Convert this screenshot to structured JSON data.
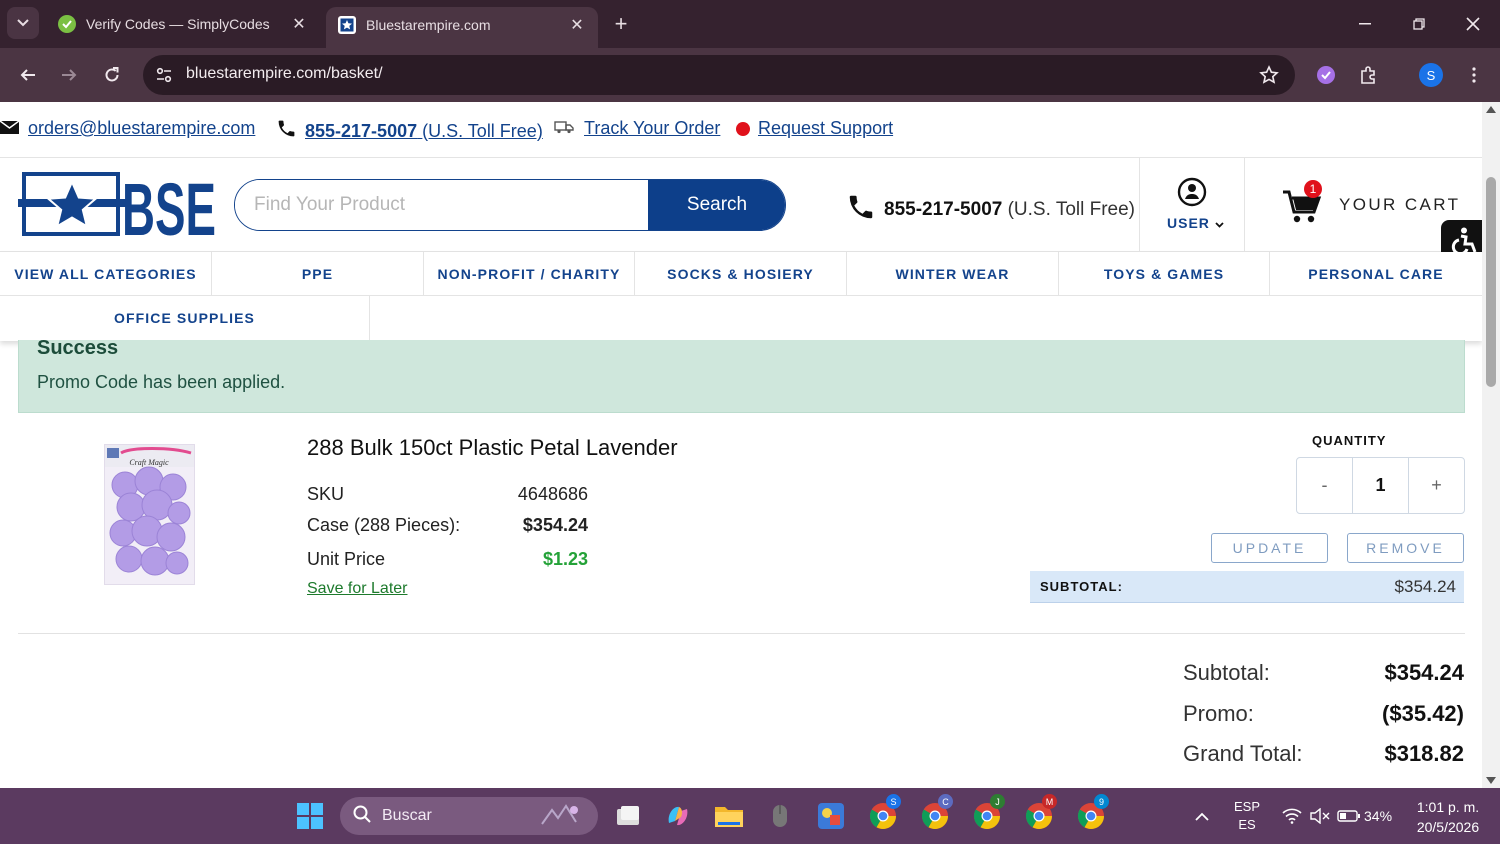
{
  "browser": {
    "tabs": [
      {
        "title": "Verify Codes — SimplyCodes",
        "active": false
      },
      {
        "title": "Bluestarempire.com",
        "active": true
      }
    ],
    "url": "bluestarempire.com/basket/",
    "profile_initial": "S"
  },
  "topbar": {
    "email": "orders@bluestarempire.com",
    "phone": "855-217-5007",
    "phone_note": "(U.S. Toll Free)",
    "track": "Track Your Order",
    "support": "Request Support"
  },
  "header": {
    "logo_text": "BSE",
    "search_placeholder": "Find Your Product",
    "search_button": "Search",
    "phone": "855-217-5007",
    "phone_note": "(U.S. Toll Free)",
    "user_label": "USER",
    "cart_label": "YOUR CART",
    "cart_count": "1"
  },
  "categories": [
    "VIEW ALL CATEGORIES",
    "PPE",
    "NON-PROFIT / CHARITY",
    "SOCKS & HOSIERY",
    "WINTER WEAR",
    "TOYS & GAMES",
    "PERSONAL CARE",
    "OFFICE SUPPLIES"
  ],
  "alert": {
    "heading": "Success",
    "message": "Promo Code has been applied."
  },
  "item": {
    "name": "288 Bulk 150ct Plastic Petal Lavender",
    "image_brand": "Craft Magic",
    "sku_label": "SKU",
    "sku": "4648686",
    "case_label": "Case (288 Pieces):",
    "case_price": "$354.24",
    "unit_label": "Unit Price",
    "unit_price": "$1.23",
    "save_later": "Save for Later",
    "quantity_label": "QUANTITY",
    "qty_minus": "-",
    "qty_value": "1",
    "qty_plus": "+",
    "update": "UPDATE",
    "remove": "REMOVE",
    "subtotal_label": "SUBTOTAL:",
    "subtotal": "$354.24"
  },
  "totals": {
    "subtotal_label": "Subtotal:",
    "subtotal": "$354.24",
    "promo_label": "Promo:",
    "promo": "($35.42)",
    "grand_label": "Grand Total:",
    "grand": "$318.82"
  },
  "taskbar": {
    "search_label": "Buscar",
    "lang_top": "ESP",
    "lang_bottom": "ES",
    "battery": "34%",
    "time": "1:01 p. m.",
    "date": "20/5/2026",
    "chrome_badges": [
      "S",
      "C",
      "J",
      "M",
      "9"
    ]
  },
  "colors": {
    "brand_blue": "#13438c",
    "success_bg": "#cfe7dc",
    "unit_price_green": "#24a238",
    "tabbar": "#35222f",
    "taskbar": "#5b3a60"
  }
}
